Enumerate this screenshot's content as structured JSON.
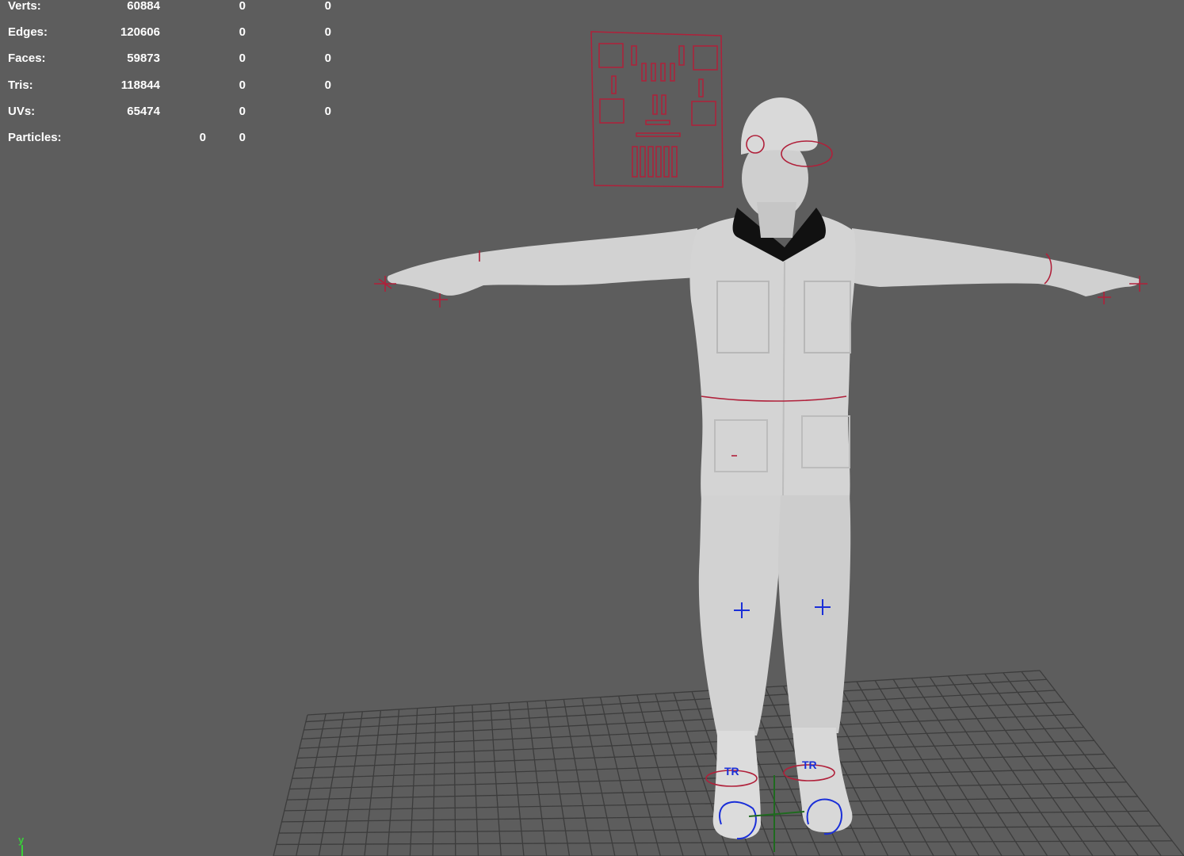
{
  "hud": {
    "rows": [
      {
        "label": "Verts:",
        "values": [
          "60884",
          "0",
          "0"
        ]
      },
      {
        "label": "Edges:",
        "values": [
          "120606",
          "0",
          "0"
        ]
      },
      {
        "label": "Faces:",
        "values": [
          "59873",
          "0",
          "0"
        ]
      },
      {
        "label": "Tris:",
        "values": [
          "118844",
          "0",
          "0"
        ]
      },
      {
        "label": "UVs:",
        "values": [
          "65474",
          "0",
          "0"
        ]
      },
      {
        "label": "Particles:",
        "values": [
          "0",
          "0"
        ]
      }
    ]
  },
  "controls": {
    "foot_left": "TR",
    "foot_right": "TR"
  },
  "axis": {
    "label": "y"
  },
  "colors": {
    "background": "#5d5d5d",
    "grid": "#3a3a3a",
    "rig_red": "#b0203a",
    "rig_blue": "#1a2fd8",
    "axis_green": "#38d038"
  }
}
